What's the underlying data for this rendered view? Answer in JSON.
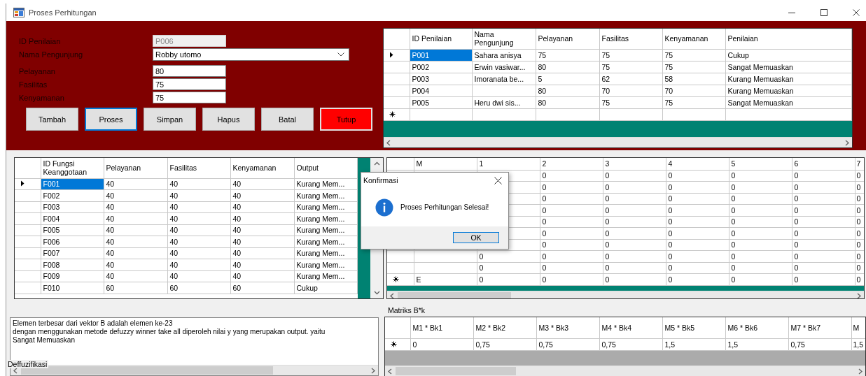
{
  "window": {
    "title": "Proses Perhitungan"
  },
  "form": {
    "field_groups": [
      [
        {
          "label": "ID Penilaian",
          "kind": "text",
          "value": "P006",
          "disabled": true
        },
        {
          "label": "Nama Pengunjung",
          "kind": "combo",
          "value": "Robby utomo",
          "disabled": false
        }
      ],
      [
        {
          "label": "Pelayanan",
          "kind": "text",
          "value": "80",
          "disabled": false
        },
        {
          "label": "Fasilitas",
          "kind": "text",
          "value": "75",
          "disabled": false
        },
        {
          "label": "Kenyamanan",
          "kind": "text",
          "value": "75",
          "disabled": false
        }
      ]
    ],
    "buttons": [
      {
        "label": "Tambah",
        "kind": "normal",
        "focused": false
      },
      {
        "label": "Proses",
        "kind": "normal",
        "focused": true
      },
      {
        "label": "Simpan",
        "kind": "normal",
        "focused": false
      },
      {
        "label": "Hapus",
        "kind": "normal",
        "focused": false
      },
      {
        "label": "Batal",
        "kind": "normal",
        "focused": false
      },
      {
        "label": "Tutup",
        "kind": "danger",
        "focused": false
      }
    ]
  },
  "penilaian_table": {
    "columns": [
      "ID Penilaian",
      "Nama Pengunjung",
      "Pelayanan",
      "Fasilitas",
      "Kenyamanan",
      "Penilaian"
    ],
    "rows": [
      {
        "kind": "data",
        "selected": true,
        "cells": [
          "P001",
          "Sahara anisya",
          "75",
          "75",
          "75",
          "Cukup"
        ]
      },
      {
        "kind": "data",
        "selected": false,
        "cells": [
          "P002",
          "Erwin vasiwar...",
          "80",
          "75",
          "75",
          "Sangat Memuaskan"
        ]
      },
      {
        "kind": "data",
        "selected": false,
        "cells": [
          "P003",
          "Imoranata be...",
          "5",
          "62",
          "58",
          "Kurang Memuaskan"
        ]
      },
      {
        "kind": "data",
        "selected": false,
        "cells": [
          "P004",
          null,
          "80",
          "70",
          "70",
          "Kurang Memuaskan"
        ]
      },
      {
        "kind": "data",
        "selected": false,
        "cells": [
          "P005",
          "Heru dwi sis...",
          "80",
          "75",
          "75",
          "Sangat Memuaskan"
        ]
      },
      {
        "kind": "new",
        "selected": false,
        "cells": [
          null,
          null,
          null,
          null,
          null,
          null
        ]
      }
    ]
  },
  "fungsi_table": {
    "columns": [
      "ID Fungsi Keanggotaan",
      "Pelayanan",
      "Fasilitas",
      "Kenyamanan",
      "Output"
    ],
    "rows": [
      {
        "kind": "data",
        "selected": true,
        "cells": [
          "F001",
          "40",
          "40",
          "40",
          "Kurang Mem..."
        ]
      },
      {
        "kind": "data",
        "selected": false,
        "cells": [
          "F002",
          "40",
          "40",
          "40",
          "Kurang Mem..."
        ]
      },
      {
        "kind": "data",
        "selected": false,
        "cells": [
          "F003",
          "40",
          "40",
          "40",
          "Kurang Mem..."
        ]
      },
      {
        "kind": "data",
        "selected": false,
        "cells": [
          "F004",
          "40",
          "40",
          "40",
          "Kurang Mem..."
        ]
      },
      {
        "kind": "data",
        "selected": false,
        "cells": [
          "F005",
          "40",
          "40",
          "40",
          "Kurang Mem..."
        ]
      },
      {
        "kind": "data",
        "selected": false,
        "cells": [
          "F006",
          "40",
          "40",
          "40",
          "Kurang Mem..."
        ]
      },
      {
        "kind": "data",
        "selected": false,
        "cells": [
          "F007",
          "40",
          "40",
          "40",
          "Kurang Mem..."
        ]
      },
      {
        "kind": "data",
        "selected": false,
        "cells": [
          "F008",
          "40",
          "40",
          "40",
          "Kurang Mem..."
        ]
      },
      {
        "kind": "data",
        "selected": false,
        "cells": [
          "F009",
          "40",
          "40",
          "40",
          "Kurang Mem..."
        ]
      },
      {
        "kind": "data",
        "selected": false,
        "cells": [
          "F010",
          "60",
          "60",
          "60",
          "Cukup"
        ]
      }
    ]
  },
  "matrix_table": {
    "columns": [
      "M",
      "1",
      "2",
      "3",
      "4",
      "5",
      "6",
      "7"
    ],
    "rows": [
      {
        "kind": "data",
        "cells": [
          null,
          null,
          "0",
          "0",
          "0",
          "0",
          "0",
          "0"
        ]
      },
      {
        "kind": "data",
        "cells": [
          null,
          null,
          "0",
          "0",
          "0",
          "0",
          "0",
          "0"
        ]
      },
      {
        "kind": "data",
        "cells": [
          null,
          null,
          "0",
          "0",
          "0",
          "0",
          "0",
          "0"
        ]
      },
      {
        "kind": "data",
        "cells": [
          null,
          null,
          "0",
          "0",
          "0",
          "0",
          "0",
          "0"
        ]
      },
      {
        "kind": "data",
        "cells": [
          null,
          null,
          "0",
          "0",
          "0",
          "0",
          "0",
          "0"
        ]
      },
      {
        "kind": "data",
        "cells": [
          null,
          null,
          "0",
          "0",
          "0",
          "0",
          "0",
          "0"
        ]
      },
      {
        "kind": "data",
        "cells": [
          null,
          null,
          "0",
          "0",
          "0",
          "0",
          "0",
          "0"
        ]
      },
      {
        "kind": "data",
        "cells": [
          null,
          "0",
          "0",
          "0",
          "0",
          "0",
          "0",
          "0"
        ]
      },
      {
        "kind": "data",
        "cells": [
          null,
          "0",
          "0",
          "0",
          "0",
          "0",
          "0",
          "0"
        ]
      },
      {
        "kind": "new",
        "cells": [
          "E",
          "0",
          "0",
          "0",
          "0",
          "0",
          "0",
          "0"
        ]
      }
    ]
  },
  "defuzzifikasi": {
    "label": "Deffuzifikasi",
    "lines": [
      "Elemen terbesar dari vektor B adalah elemen ke-23",
      "dengan menggunakan metode defuzzy winner take all diperoleh nilai y yang merupakan output. yaitu",
      "Sangat Memuaskan"
    ]
  },
  "bk_table": {
    "label": "Matriks B*k",
    "columns": [
      "M1 * Bk1",
      "M2 * Bk2",
      "M3 * Bk3",
      "M4 * Bk4",
      "M5 * Bk5",
      "M6 * Bk6",
      "M7 * Bk7",
      "M"
    ],
    "rows": [
      {
        "kind": "new",
        "cells": [
          "0",
          "0,75",
          "0,75",
          "0,75",
          "1,5",
          "1,5",
          "0,75",
          "1,5"
        ]
      }
    ]
  },
  "dialog": {
    "title": "Konfirmasi",
    "message": "Proses Perhitungan Selesai!",
    "button": "OK"
  }
}
